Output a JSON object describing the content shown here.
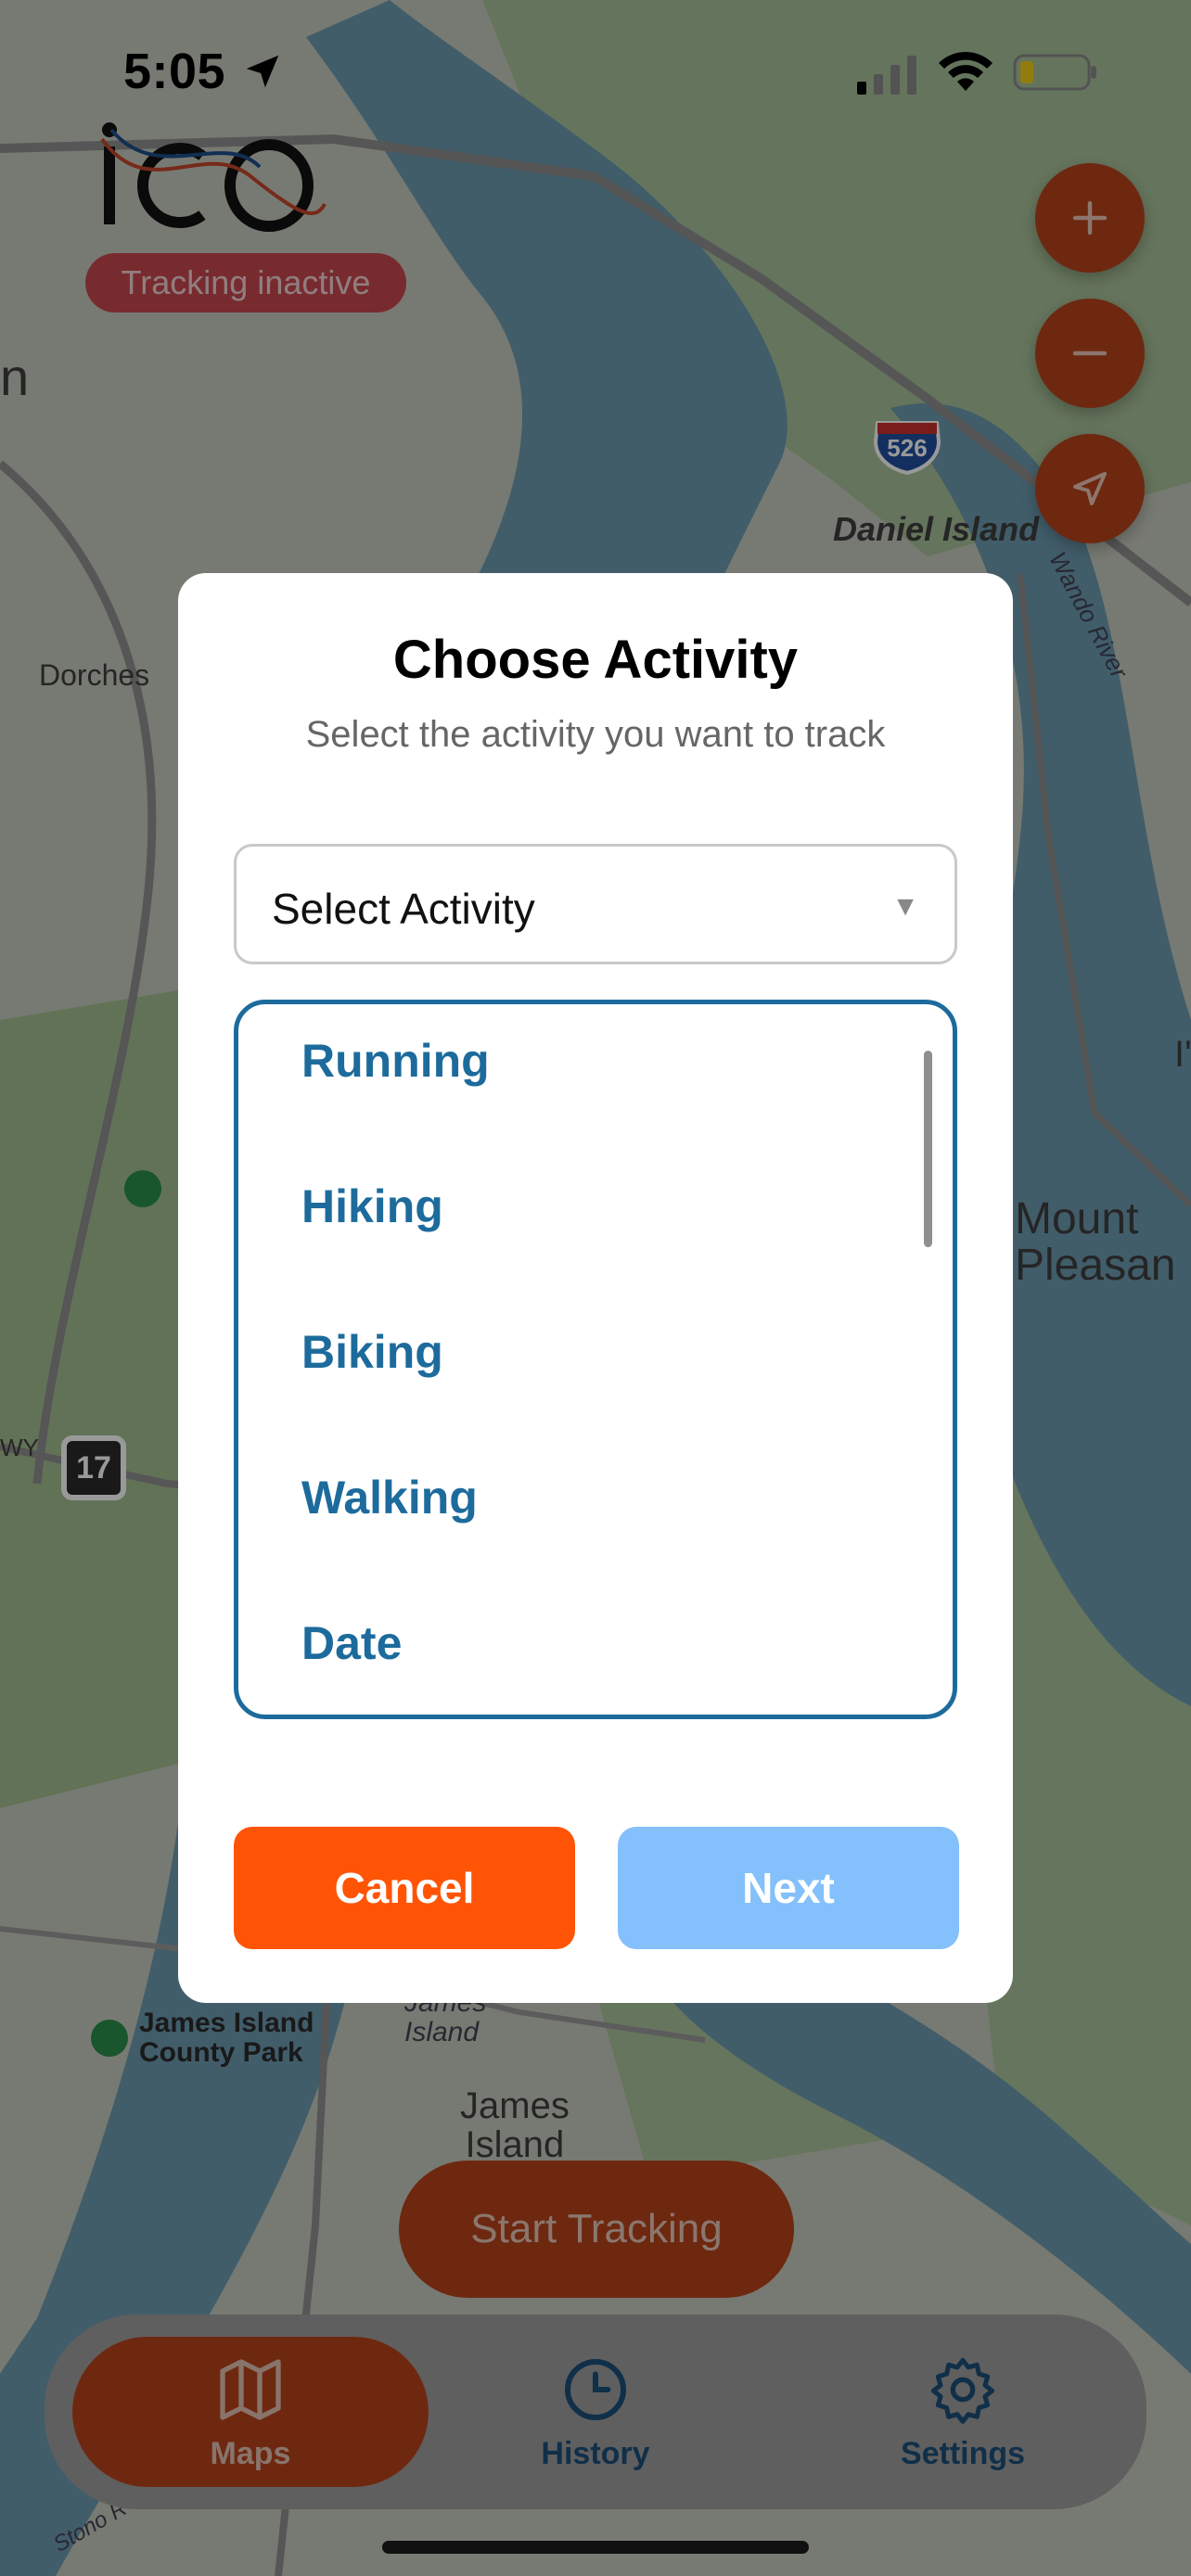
{
  "status_bar": {
    "time": "5:05"
  },
  "header": {
    "tracking_status": "Tracking inactive"
  },
  "map": {
    "labels": {
      "daniel_island": "Daniel\nIsland",
      "wando_river": "Wando River",
      "dorchester": "Dorches",
      "mount_pleasant": "Mount\nPleasan",
      "james_island_county_park": "James Island\nCounty Park",
      "james_island_small": "James\nIsland",
      "james_island": "James\nIsland",
      "partial_n": "n",
      "partial_i": "I'",
      "hwy_partial": "WY",
      "stono_river": "Stono R"
    },
    "shields": {
      "interstate": "526",
      "us_route": "17"
    },
    "controls": {
      "zoom_in": "plus-icon",
      "zoom_out": "minus-icon",
      "locate": "navigation-arrow-icon"
    }
  },
  "modal": {
    "title": "Choose Activity",
    "subtitle": "Select the activity you want to track",
    "select_label": "Select Activity",
    "select_caret": "▼",
    "options": [
      "Running",
      "Hiking",
      "Biking",
      "Walking",
      "Date"
    ],
    "cancel_label": "Cancel",
    "next_label": "Next"
  },
  "start_button": "Start Tracking",
  "tabs": [
    {
      "label": "Maps",
      "icon": "map-icon"
    },
    {
      "label": "History",
      "icon": "clock-icon"
    },
    {
      "label": "Settings",
      "icon": "gear-icon"
    }
  ],
  "colors": {
    "accent": "#ff5406",
    "primary_blue": "#1d6b9c",
    "next_disabled": "#84c0fb",
    "badge": "#c8494f"
  }
}
